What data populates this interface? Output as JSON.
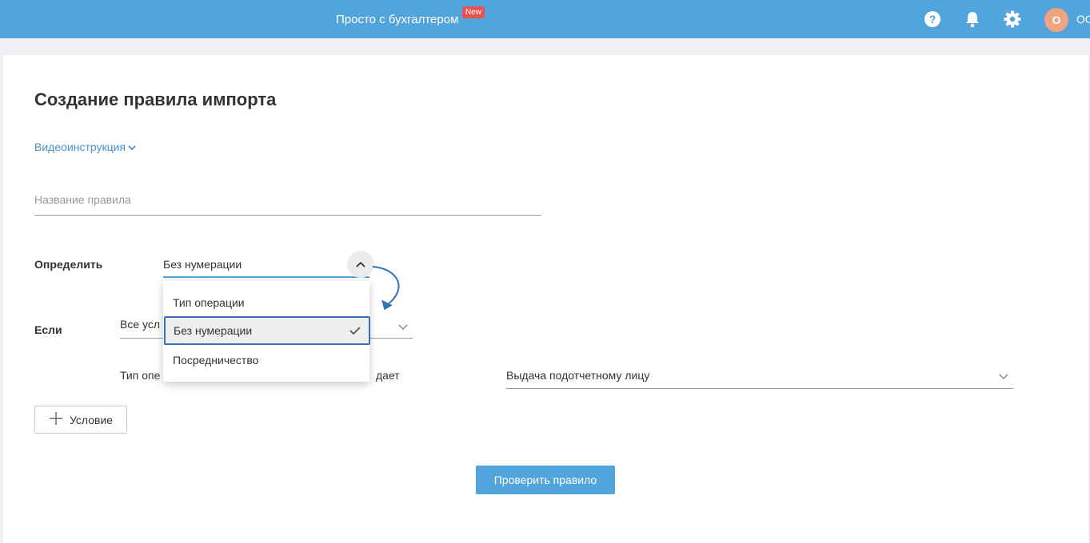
{
  "header": {
    "brand": "Просто с бухгалтером",
    "badge": "New",
    "avatar_letter": "О",
    "user_name": "ОО",
    "icons": [
      "help-icon",
      "bell-icon",
      "gear-icon"
    ],
    "bg_color": "#52a4dc"
  },
  "page": {
    "title": "Создание правила импорта",
    "video_link": "Видеоинструкция"
  },
  "rule_name": {
    "placeholder": "Название правила",
    "value": ""
  },
  "define": {
    "label": "Определить",
    "selected": "Без нумерации",
    "options": [
      "Тип операции",
      "Без нумерации",
      "Посредничество"
    ]
  },
  "if": {
    "label": "Если",
    "selected": "Все усл"
  },
  "condition": {
    "field_label": "Тип опе",
    "operator_tail": "дает",
    "value": "Выдача подотчетному лицу"
  },
  "buttons": {
    "add_condition": "Условие",
    "check_rule": "Проверить правило"
  },
  "colors": {
    "accent": "#52a4dc",
    "focus_border": "#3471b6",
    "badge": "#e8534f",
    "avatar": "#f0a37f"
  }
}
